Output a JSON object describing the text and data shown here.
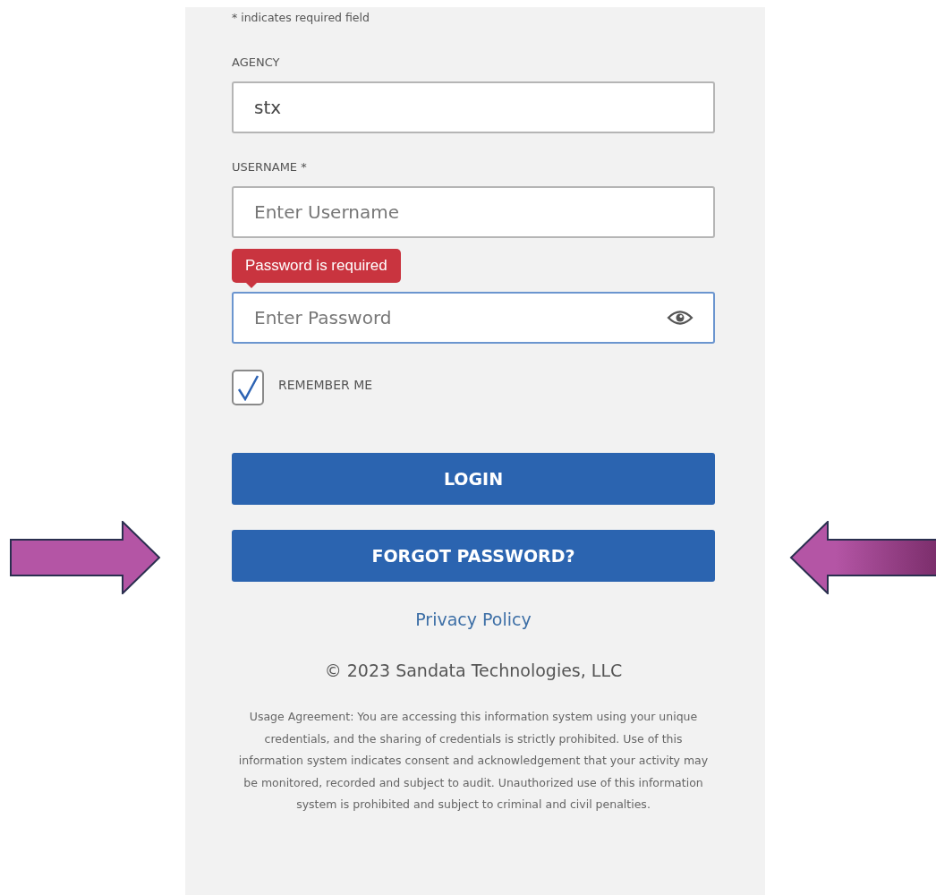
{
  "required_note": "* indicates required field",
  "fields": [
    {
      "label": "AGENCY",
      "value": "stx",
      "focused": false
    },
    {
      "label": "USERNAME *",
      "placeholder": "Enter Username",
      "focused": false
    },
    {
      "placeholder": "Enter Password",
      "focused": true,
      "error": "Password is required",
      "reveal_toggle": true
    }
  ],
  "remember_me": {
    "label": "REMEMBER ME",
    "checked": true
  },
  "buttons": [
    "LOGIN",
    "FORGOT PASSWORD?"
  ],
  "privacy_link": "Privacy Policy",
  "copyright": "© 2023 Sandata Technologies, LLC",
  "usage_agreement": "Usage Agreement: You are accessing this information system using your unique credentials, and the sharing of credentials is strictly prohibited. Use of this information system indicates consent and acknowledgement that your activity may be monitored, recorded and subject to audit. Unauthorized use of this information system is prohibited and subject to criminal and civil penalties.",
  "annotations": [
    {
      "kind": "right_arrow"
    },
    {
      "kind": "left_arrow"
    }
  ]
}
